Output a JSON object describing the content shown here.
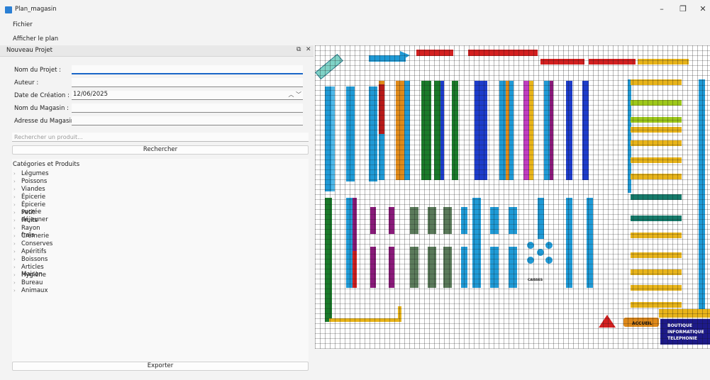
{
  "window": {
    "title": "Plan_magasin",
    "icon": "app-icon"
  },
  "menubar": {
    "file": "Fichier"
  },
  "toolbar": {
    "show_plan": "Afficher le plan"
  },
  "panel": {
    "title": "Nouveau Projet",
    "float_icon": "float-icon",
    "close_icon": "close-icon"
  },
  "form": {
    "project_name_label": "Nom du Projet :",
    "project_name_value": "",
    "author_label": "Auteur :",
    "author_value": "",
    "date_label": "Date de Création :",
    "date_value": "12/06/2025",
    "store_name_label": "Nom du Magasin :",
    "store_name_value": "",
    "store_address_label": "Adresse du Magasin :",
    "store_address_value": ""
  },
  "search": {
    "placeholder": "Rechercher un produit...",
    "button": "Rechercher"
  },
  "tree": {
    "header": "Catégories et Produits",
    "items": [
      "Légumes",
      "Poissons",
      "Viandes",
      "Épicerie",
      "Épicerie sucrée",
      "Petit déjeuner",
      "Fruits",
      "Rayon frais",
      "Crèmerie",
      "Conserves",
      "Apéritifs",
      "Boissons",
      "Articles Maison",
      "Hygiène",
      "Bureau",
      "Animaux"
    ]
  },
  "export_button": "Exporter",
  "plan": {
    "accent_colors": {
      "blue": "#1f9ad6",
      "green": "#1a7a2a",
      "red": "#d42020",
      "orange": "#e08a1a",
      "navy": "#1d3ccb",
      "yellow": "#e8b41a",
      "purple": "#8a1a7a",
      "teal": "#157a6a"
    },
    "labels": {
      "accueil": "ACCUEIL",
      "caisses": "CAISSES",
      "boutique": [
        "BOUTIQUE",
        "INFORMATIQUE",
        "TELEPHONIE"
      ]
    }
  }
}
